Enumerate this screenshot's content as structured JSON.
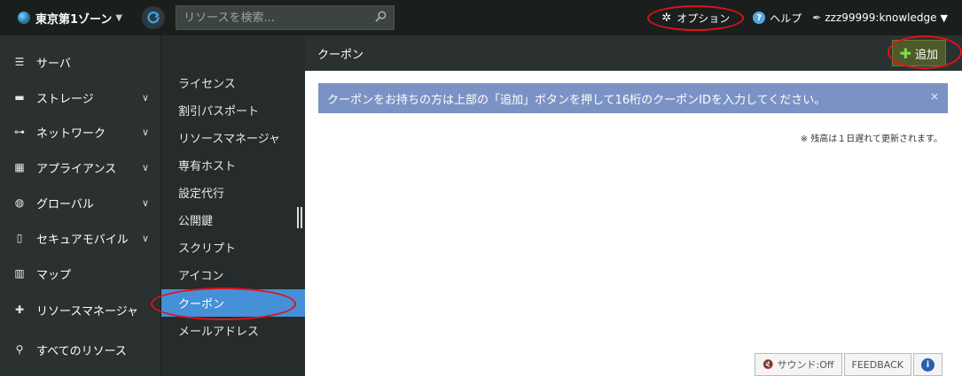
{
  "topbar": {
    "zone": "東京第1ゾーン",
    "search_placeholder": "リソースを検索...",
    "option_label": "オプション",
    "help_label": "ヘルプ",
    "user_label": "zzz99999:knowledge"
  },
  "sidebar": {
    "items": [
      {
        "label": "サーバ"
      },
      {
        "label": "ストレージ"
      },
      {
        "label": "ネットワーク"
      },
      {
        "label": "アプライアンス"
      },
      {
        "label": "グローバル"
      },
      {
        "label": "セキュアモバイル"
      },
      {
        "label": "マップ"
      },
      {
        "label": "リソースマネージャ"
      },
      {
        "label": "すべてのリソース"
      }
    ]
  },
  "submenu": {
    "items": [
      {
        "label": "ライセンス"
      },
      {
        "label": "割引パスポート"
      },
      {
        "label": "リソースマネージャ"
      },
      {
        "label": "専有ホスト"
      },
      {
        "label": "設定代行"
      },
      {
        "label": "公開鍵"
      },
      {
        "label": "スクリプト"
      },
      {
        "label": "アイコン"
      },
      {
        "label": "クーポン"
      },
      {
        "label": "メールアドレス"
      }
    ],
    "active": "クーポン"
  },
  "main": {
    "title": "クーポン",
    "add_label": "追加",
    "alert_text": "クーポンをお持ちの方は上部の「追加」ボタンを押して16桁のクーポンIDを入力してください。",
    "alert_close": "×",
    "note": "※ 残高は１日遅れて更新されます。"
  },
  "footer": {
    "sound_label": "サウンド:Off",
    "feedback_label": "FEEDBACK",
    "info_glyph": "i"
  },
  "colors": {
    "accent_blue": "#4590d6",
    "alert_bg": "#7b93c4",
    "highlight_red": "#e0121a",
    "add_plus": "#7fd94a"
  }
}
